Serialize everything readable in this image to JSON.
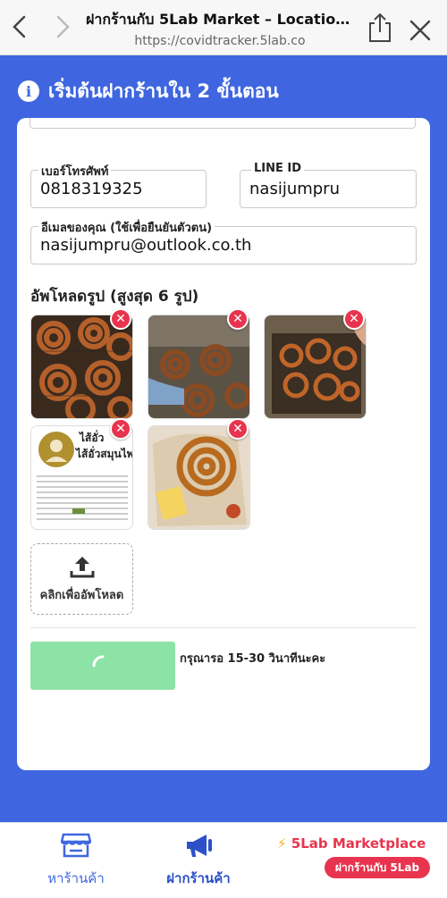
{
  "browser": {
    "title": "ฝากร้านกับ 5Lab Market – Location-...",
    "url": "https://covidtracker.5lab.co"
  },
  "header": {
    "step_title": "เริ่มต้นฝากร้านใน 2 ขั้นตอน"
  },
  "form": {
    "phone_label": "เบอร์โทรศัพท์",
    "phone_value": "0818319325",
    "line_label": "LINE ID",
    "line_value": "nasijumpru",
    "email_label": "อีเมลของคุณ (ใช้เพื่อยืนยันตัวตน)",
    "email_value": "nasijumpru@outlook.co.th"
  },
  "upload": {
    "heading": "อัพโหลดรูป (สูงสุด 6 รูป)",
    "button_label": "คลิกเพื่ออัพโหลด",
    "remove_symbol": "✕",
    "label_card_title1": "ไส้อั่ว",
    "label_card_title2": "ไส้อั่วสมุนไพร"
  },
  "submit": {
    "wait_text": "กรุณารอ 15-30 วินาทีนะคะ",
    "color": "#8de3a6"
  },
  "tabbar": {
    "find_shop": "หาร้านค้า",
    "post_shop": "ฝากร้านค้า",
    "marketplace_bolt": "⚡",
    "marketplace": "5Lab Marketplace",
    "marketplace_badge": "ฝากร้านกับ 5Lab"
  },
  "colors": {
    "primary": "#3f66e0",
    "danger": "#e8344e"
  }
}
